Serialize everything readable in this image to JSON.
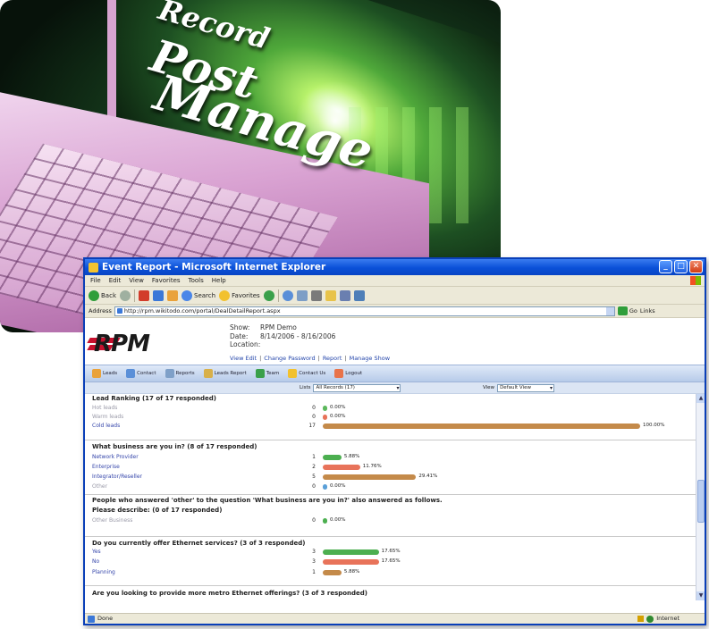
{
  "hero": {
    "words": [
      "Record",
      "Post",
      "Manage"
    ]
  },
  "window": {
    "title": "Event Report - Microsoft Internet Explorer",
    "menu": [
      "File",
      "Edit",
      "View",
      "Favorites",
      "Tools",
      "Help"
    ],
    "toolbar": {
      "back": "Back",
      "search": "Search",
      "favorites": "Favorites"
    },
    "address_label": "Address",
    "address_url": "http://rpm.wikitodo.com/portal/DealDetailReport.aspx",
    "go": "Go",
    "links": "Links",
    "status": "Done",
    "zone": "Internet"
  },
  "page": {
    "logo": "RPM",
    "event": {
      "show_label": "Show:",
      "show_value": "RPM Demo",
      "date_label": "Date:",
      "date_value": "8/14/2006 - 8/16/2006",
      "location_label": "Location:",
      "location_value": ""
    },
    "event_links": [
      "View Edit",
      "Change Password",
      "Report",
      "Manage Show"
    ],
    "nav": [
      "Leads",
      "Contact",
      "Reports",
      "Leads Report",
      "Team",
      "Contact Us",
      "Logout"
    ],
    "filters": {
      "lists_label": "Lists",
      "lists_value": "All Records (17)",
      "view_label": "View",
      "view_value": "Default View"
    }
  },
  "report": {
    "q1": {
      "title": "Lead Ranking (17 of 17 responded)",
      "rows": [
        {
          "label": "Hot leads",
          "count": "0",
          "pct_text": "0.00%",
          "pct": 0,
          "color": "#5cb85c",
          "dim": true
        },
        {
          "label": "Warm leads",
          "count": "0",
          "pct_text": "0.00%",
          "pct": 0,
          "color": "#e8735a",
          "dim": true
        },
        {
          "label": "Cold leads",
          "count": "17",
          "pct_text": "100.00%",
          "pct": 100,
          "color": "#c48a4a",
          "dim": false
        }
      ]
    },
    "q2": {
      "title": "What business are you in? (8 of 17 responded)",
      "rows": [
        {
          "label": "Network Provider",
          "count": "1",
          "pct_text": "5.88%",
          "pct": 5.88,
          "color": "#4caf50",
          "dim": false
        },
        {
          "label": "Enterprise",
          "count": "2",
          "pct_text": "11.76%",
          "pct": 11.76,
          "color": "#e8735a",
          "dim": false
        },
        {
          "label": "Integrator/Reseller",
          "count": "5",
          "pct_text": "29.41%",
          "pct": 29.41,
          "color": "#c48a4a",
          "dim": false
        },
        {
          "label": "Other",
          "count": "0",
          "pct_text": "0.00%",
          "pct": 0,
          "color": "#5aa0d8",
          "dim": true
        }
      ],
      "note": "People who answered 'other' to the question 'What business are you in?' also answered as follows.",
      "sub_title": "Please describe: (0 of 17 responded)",
      "sub_row": {
        "label": "Other Business",
        "count": "0",
        "pct_text": "0.00%",
        "pct": 0,
        "color": "#4caf50",
        "dim": true
      }
    },
    "q3": {
      "title": "Do you currently offer Ethernet services? (3 of 3 responded)",
      "rows": [
        {
          "label": "Yes",
          "count": "3",
          "pct_text": "17.65%",
          "pct": 17.65,
          "color": "#4caf50",
          "dim": false
        },
        {
          "label": "No",
          "count": "3",
          "pct_text": "17.65%",
          "pct": 17.65,
          "color": "#e8735a",
          "dim": false
        },
        {
          "label": "Planning",
          "count": "1",
          "pct_text": "5.88%",
          "pct": 5.88,
          "color": "#c48a4a",
          "dim": false
        }
      ]
    },
    "q4": {
      "title": "Are you looking to provide more metro Ethernet offerings? (3 of 3 responded)"
    }
  }
}
